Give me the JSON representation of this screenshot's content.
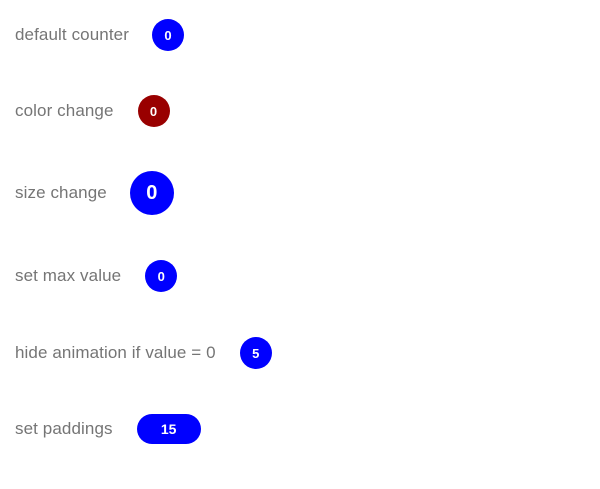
{
  "colors": {
    "badge_blue": "#0000ff",
    "badge_red": "#990000",
    "label_gray": "#757575",
    "background": "#ffffff"
  },
  "rows": [
    {
      "label": "default counter",
      "value": "0",
      "color": "#0000ff"
    },
    {
      "label": "color change",
      "value": "0",
      "color": "#990000"
    },
    {
      "label": "size change",
      "value": "0",
      "color": "#0000ff"
    },
    {
      "label": "set max value",
      "value": "0",
      "color": "#0000ff"
    },
    {
      "label": "hide animation if value = 0",
      "value": "5",
      "color": "#0000ff"
    },
    {
      "label": "set paddings",
      "value": "15",
      "color": "#0000ff"
    }
  ]
}
